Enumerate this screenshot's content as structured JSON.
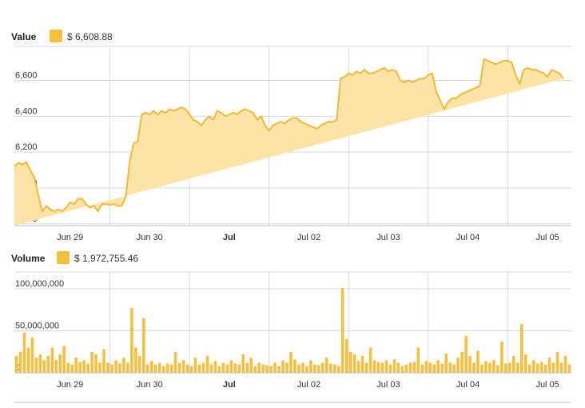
{
  "colors": {
    "accent": "#f5bf3f",
    "area_fill": "#fbe4a6",
    "line": "#f0b93a",
    "grid": "#d9d9d9"
  },
  "legend": {
    "value": {
      "label": "Value",
      "amount": "$ 6,608.88"
    },
    "volume": {
      "label": "Volume",
      "amount": "$ 1,972,755.46"
    }
  },
  "chart_data": [
    {
      "type": "area",
      "title": "",
      "xlabel": "",
      "ylabel": "",
      "series_label": "Value",
      "ylim": [
        5790,
        6790
      ],
      "yticks": [
        {
          "value": 5800,
          "label": "5,800"
        },
        {
          "value": 6000,
          "label": "6,000"
        },
        {
          "value": 6200,
          "label": "6,200"
        },
        {
          "value": 6400,
          "label": "6,400"
        },
        {
          "value": 6600,
          "label": "6,600"
        }
      ],
      "xlim": [
        0,
        7.0
      ],
      "xticks": [
        {
          "value": 0.7,
          "label": "Jun 29",
          "bold": false
        },
        {
          "value": 1.7,
          "label": "Jun 30",
          "bold": false
        },
        {
          "value": 2.7,
          "label": "Jul",
          "bold": true
        },
        {
          "value": 3.7,
          "label": "Jul 02",
          "bold": false
        },
        {
          "value": 4.7,
          "label": "Jul 03",
          "bold": false
        },
        {
          "value": 5.7,
          "label": "Jul 04",
          "bold": false
        },
        {
          "value": 6.7,
          "label": "Jul 05",
          "bold": false
        }
      ],
      "gridlines_x": [
        1.2,
        2.2,
        3.2,
        4.2,
        5.2,
        6.2
      ],
      "grid": true,
      "x": [
        0.0,
        0.05,
        0.1,
        0.15,
        0.2,
        0.25,
        0.3,
        0.35,
        0.4,
        0.45,
        0.5,
        0.55,
        0.6,
        0.65,
        0.7,
        0.75,
        0.8,
        0.85,
        0.9,
        0.95,
        1.0,
        1.05,
        1.1,
        1.15,
        1.2,
        1.25,
        1.3,
        1.35,
        1.4,
        1.45,
        1.5,
        1.55,
        1.6,
        1.65,
        1.7,
        1.75,
        1.8,
        1.85,
        1.9,
        1.95,
        2.0,
        2.05,
        2.1,
        2.15,
        2.2,
        2.25,
        2.3,
        2.35,
        2.4,
        2.45,
        2.5,
        2.55,
        2.6,
        2.65,
        2.7,
        2.75,
        2.8,
        2.85,
        2.9,
        2.95,
        3.0,
        3.05,
        3.1,
        3.15,
        3.2,
        3.25,
        3.3,
        3.35,
        3.4,
        3.45,
        3.5,
        3.55,
        3.6,
        3.65,
        3.7,
        3.75,
        3.8,
        3.85,
        3.9,
        3.95,
        4.0,
        4.05,
        4.1,
        4.15,
        4.2,
        4.25,
        4.3,
        4.35,
        4.4,
        4.45,
        4.5,
        4.55,
        4.6,
        4.65,
        4.7,
        4.75,
        4.8,
        4.85,
        4.9,
        4.95,
        5.0,
        5.05,
        5.1,
        5.15,
        5.2,
        5.25,
        5.3,
        5.35,
        5.4,
        5.45,
        5.5,
        5.55,
        5.6,
        5.65,
        5.7,
        5.75,
        5.8,
        5.85,
        5.9,
        5.95,
        6.0,
        6.05,
        6.1,
        6.15,
        6.2,
        6.25,
        6.3,
        6.35,
        6.4,
        6.45,
        6.5,
        6.55,
        6.6,
        6.65,
        6.7,
        6.75,
        6.8,
        6.85,
        6.9,
        6.95,
        7.0
      ],
      "values": [
        6120,
        6140,
        6130,
        6145,
        6100,
        6060,
        5960,
        5870,
        5900,
        5880,
        5870,
        5880,
        5870,
        5890,
        5920,
        5910,
        5940,
        5940,
        5910,
        5890,
        5900,
        5870,
        5910,
        5910,
        5905,
        5910,
        5900,
        5900,
        5950,
        6150,
        6250,
        6260,
        6410,
        6420,
        6410,
        6430,
        6410,
        6430,
        6420,
        6440,
        6430,
        6440,
        6450,
        6440,
        6410,
        6380,
        6370,
        6350,
        6380,
        6400,
        6380,
        6430,
        6420,
        6400,
        6410,
        6420,
        6410,
        6430,
        6440,
        6430,
        6420,
        6380,
        6400,
        6350,
        6320,
        6350,
        6360,
        6370,
        6360,
        6380,
        6390,
        6390,
        6370,
        6360,
        6350,
        6340,
        6330,
        6350,
        6360,
        6370,
        6370,
        6380,
        6610,
        6620,
        6640,
        6630,
        6650,
        6640,
        6660,
        6640,
        6640,
        6650,
        6660,
        6670,
        6650,
        6660,
        6650,
        6600,
        6590,
        6600,
        6590,
        6600,
        6610,
        6610,
        6630,
        6640,
        6540,
        6490,
        6440,
        6480,
        6500,
        6500,
        6520,
        6530,
        6540,
        6550,
        6560,
        6570,
        6720,
        6710,
        6700,
        6690,
        6700,
        6710,
        6710,
        6700,
        6630,
        6580,
        6660,
        6670,
        6660,
        6660,
        6650,
        6640,
        6620,
        6660,
        6650,
        6640,
        6610
      ]
    },
    {
      "type": "bar",
      "title": "",
      "xlabel": "",
      "ylabel": "",
      "series_label": "Volume",
      "ylim": [
        0,
        120000000
      ],
      "yticks": [
        {
          "value": 0,
          "label": "0"
        },
        {
          "value": 50000000,
          "label": "50,000,000"
        },
        {
          "value": 100000000,
          "label": "100,000,000"
        }
      ],
      "xlim": [
        0,
        7.0
      ],
      "xticks": [
        {
          "value": 0.7,
          "label": "Jun 29",
          "bold": false
        },
        {
          "value": 1.7,
          "label": "Jun 30",
          "bold": false
        },
        {
          "value": 2.7,
          "label": "Jul",
          "bold": true
        },
        {
          "value": 3.7,
          "label": "Jul 02",
          "bold": false
        },
        {
          "value": 4.7,
          "label": "Jul 03",
          "bold": false
        },
        {
          "value": 5.7,
          "label": "Jul 04",
          "bold": false
        },
        {
          "value": 6.7,
          "label": "Jul 05",
          "bold": false
        }
      ],
      "gridlines_x": [
        1.2,
        2.2,
        3.2,
        4.2,
        5.2,
        6.2
      ],
      "grid": true,
      "x": [
        0.0,
        0.05,
        0.1,
        0.15,
        0.2,
        0.25,
        0.3,
        0.35,
        0.4,
        0.45,
        0.5,
        0.55,
        0.6,
        0.65,
        0.7,
        0.75,
        0.8,
        0.85,
        0.9,
        0.95,
        1.0,
        1.05,
        1.1,
        1.15,
        1.2,
        1.25,
        1.3,
        1.35,
        1.4,
        1.45,
        1.5,
        1.55,
        1.6,
        1.65,
        1.7,
        1.75,
        1.8,
        1.85,
        1.9,
        1.95,
        2.0,
        2.05,
        2.1,
        2.15,
        2.2,
        2.25,
        2.3,
        2.35,
        2.4,
        2.45,
        2.5,
        2.55,
        2.6,
        2.65,
        2.7,
        2.75,
        2.8,
        2.85,
        2.9,
        2.95,
        3.0,
        3.05,
        3.1,
        3.15,
        3.2,
        3.25,
        3.3,
        3.35,
        3.4,
        3.45,
        3.5,
        3.55,
        3.6,
        3.65,
        3.7,
        3.75,
        3.8,
        3.85,
        3.9,
        3.95,
        4.0,
        4.05,
        4.1,
        4.15,
        4.2,
        4.25,
        4.3,
        4.35,
        4.4,
        4.45,
        4.5,
        4.55,
        4.6,
        4.65,
        4.7,
        4.75,
        4.8,
        4.85,
        4.9,
        4.95,
        5.0,
        5.05,
        5.1,
        5.15,
        5.2,
        5.25,
        5.3,
        5.35,
        5.4,
        5.45,
        5.5,
        5.55,
        5.6,
        5.65,
        5.7,
        5.75,
        5.8,
        5.85,
        5.9,
        5.95,
        6.0,
        6.05,
        6.1,
        6.15,
        6.2,
        6.25,
        6.3,
        6.35,
        6.4,
        6.45,
        6.5,
        6.55,
        6.6,
        6.65,
        6.7,
        6.75,
        6.8,
        6.85,
        6.9,
        6.95
      ],
      "values": [
        20000000,
        25000000,
        48000000,
        30000000,
        42000000,
        18000000,
        22000000,
        15000000,
        20000000,
        30000000,
        15000000,
        22000000,
        32000000,
        12000000,
        10000000,
        18000000,
        13000000,
        15000000,
        11000000,
        25000000,
        22000000,
        12000000,
        28000000,
        12000000,
        10000000,
        15000000,
        11000000,
        18000000,
        12000000,
        77000000,
        30000000,
        20000000,
        65000000,
        10000000,
        14000000,
        10000000,
        12000000,
        8000000,
        11000000,
        10000000,
        25000000,
        12000000,
        15000000,
        10000000,
        8000000,
        18000000,
        10000000,
        12000000,
        20000000,
        10000000,
        14000000,
        8000000,
        12000000,
        10000000,
        15000000,
        11000000,
        10000000,
        22000000,
        12000000,
        18000000,
        8000000,
        12000000,
        10000000,
        9000000,
        8000000,
        12000000,
        8000000,
        15000000,
        12000000,
        25000000,
        16000000,
        10000000,
        12000000,
        8000000,
        15000000,
        10000000,
        9000000,
        12000000,
        18000000,
        11000000,
        10000000,
        8000000,
        101000000,
        40000000,
        25000000,
        22000000,
        14000000,
        20000000,
        12000000,
        30000000,
        15000000,
        13000000,
        12000000,
        15000000,
        10000000,
        16000000,
        12000000,
        8000000,
        10000000,
        12000000,
        13000000,
        30000000,
        10000000,
        14000000,
        12000000,
        10000000,
        15000000,
        11000000,
        23000000,
        12000000,
        10000000,
        18000000,
        25000000,
        44000000,
        20000000,
        12000000,
        26000000,
        10000000,
        14000000,
        12000000,
        15000000,
        9000000,
        37000000,
        11000000,
        12000000,
        20000000,
        12000000,
        58000000,
        22000000,
        10000000,
        15000000,
        11000000,
        13000000,
        10000000,
        18000000,
        12000000,
        25000000,
        12000000,
        20000000,
        10000000
      ]
    }
  ]
}
